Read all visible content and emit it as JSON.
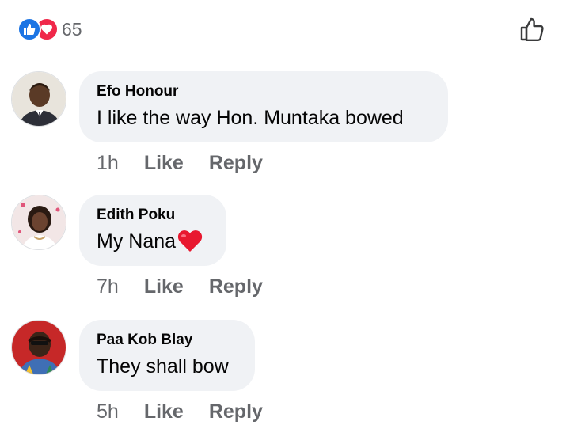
{
  "reactions": {
    "count": "65",
    "icons": [
      "like-icon",
      "love-icon"
    ],
    "like_color": "#1b74e4",
    "love_color": "#f0284a"
  },
  "comments": [
    {
      "author": "Efo Honour",
      "text": "I like the way Hon. Muntaka bowed",
      "time": "1h",
      "like_label": "Like",
      "reply_label": "Reply"
    },
    {
      "author": "Edith Poku",
      "text": "My Nana",
      "emoji": "red-heart-icon",
      "time": "7h",
      "like_label": "Like",
      "reply_label": "Reply"
    },
    {
      "author": "Paa Kob Blay",
      "text": "They shall bow",
      "time": "5h",
      "like_label": "Like",
      "reply_label": "Reply"
    }
  ],
  "colors": {
    "bubble_bg": "#f0f2f5",
    "meta_text": "#65676b"
  }
}
